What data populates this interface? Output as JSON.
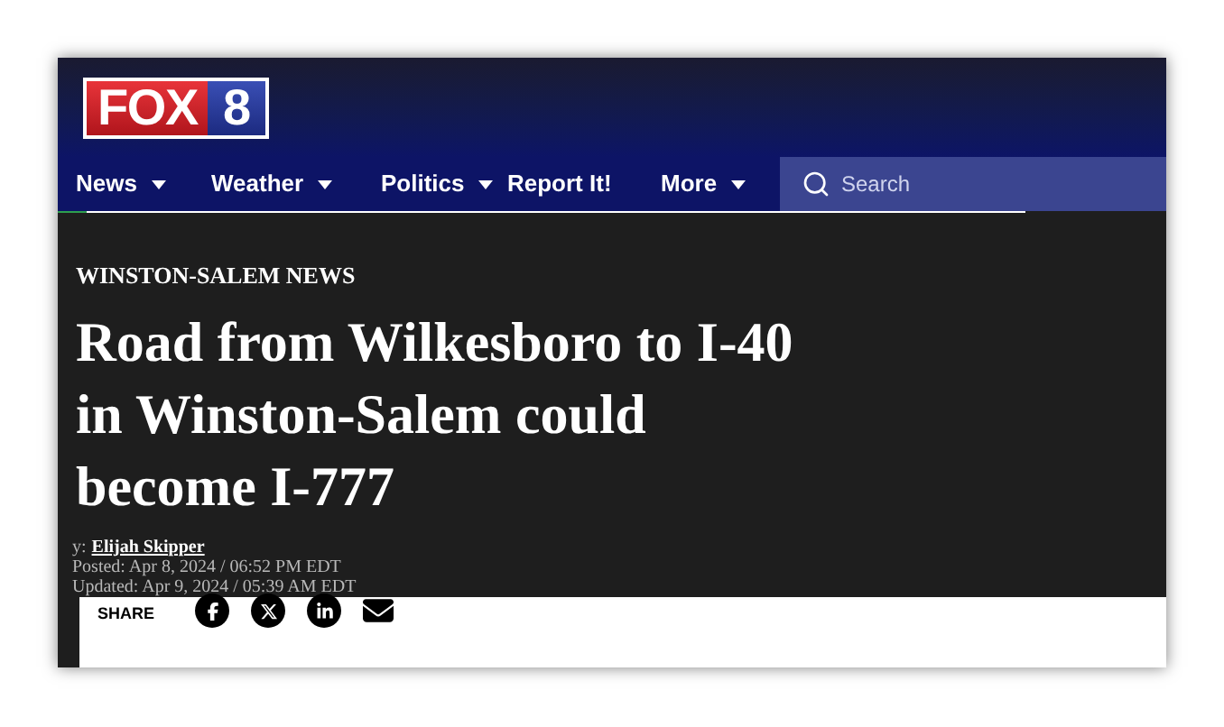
{
  "logo": {
    "brand": "FOX",
    "number": "8"
  },
  "nav": {
    "items": [
      {
        "label": "News",
        "has_menu": true
      },
      {
        "label": "Weather",
        "has_menu": true
      },
      {
        "label": "Politics",
        "has_menu": true
      },
      {
        "label": "Report It!",
        "has_menu": false
      },
      {
        "label": "More",
        "has_menu": true
      }
    ],
    "search": {
      "placeholder": "Search"
    }
  },
  "article": {
    "category": "WINSTON-SALEM NEWS",
    "headline": "Road from Wilkesboro to I-40 in Winston-Salem could become I-777",
    "byline_prefix": "y:",
    "author": "Elijah Skipper",
    "posted": "Posted: Apr 8, 2024 / 06:52 PM EDT",
    "updated": "Updated: Apr 9, 2024 / 05:39 AM EDT"
  },
  "share": {
    "label": "SHARE",
    "icons": [
      {
        "kind": "facebook"
      },
      {
        "kind": "x"
      },
      {
        "kind": "linkedin"
      },
      {
        "kind": "email"
      }
    ]
  }
}
